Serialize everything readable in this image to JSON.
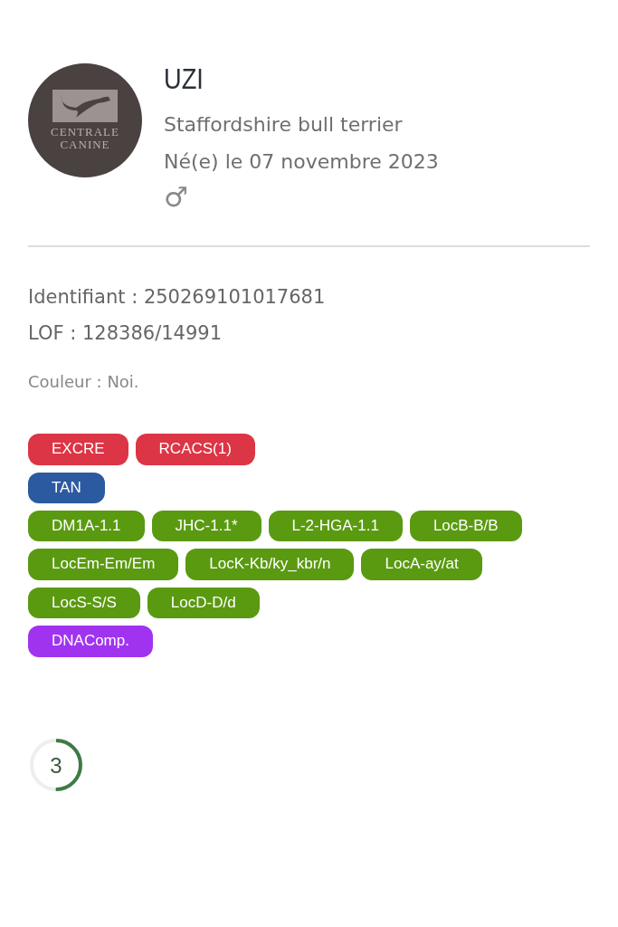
{
  "logo": {
    "line1": "CENTRALE",
    "line2": "CANINE"
  },
  "dog": {
    "name": "UZI",
    "breed": "Staffordshire bull terrier",
    "birth": "Né(e) le 07 novembre 2023",
    "sex": "♂"
  },
  "identifiers": [
    "Identifiant : 250269101017681",
    "LOF : 128386/14991"
  ],
  "color_text": "Couleur : Noi.",
  "tag_groups": [
    {
      "color": "#dc3545",
      "tags": [
        "EXCRE",
        "RCACS(1)"
      ]
    },
    {
      "color": "#2c5aa0",
      "tags": [
        "TAN"
      ]
    },
    {
      "color": "#5a9a10",
      "tags": [
        "DM1A-1.1",
        "JHC-1.1*",
        "L-2-HGA-1.1",
        "LocB-B/B",
        "LocEm-Em/Em",
        "LocK-Kb/ky_kbr/n",
        "LocA-ay/at",
        "LocS-S/S",
        "LocD-D/d"
      ]
    },
    {
      "color": "#a033f0",
      "tags": [
        "DNAComp."
      ]
    }
  ],
  "score": {
    "value": "3",
    "level": 0.5
  }
}
